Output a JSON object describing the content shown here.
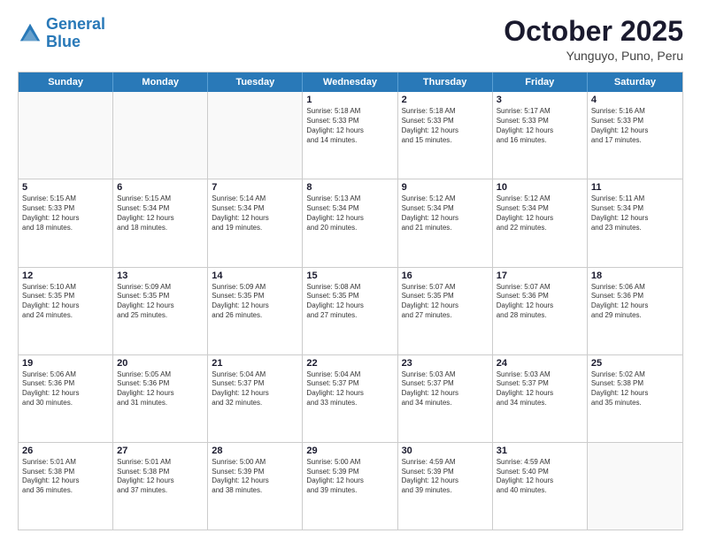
{
  "logo": {
    "text_general": "General",
    "text_blue": "Blue"
  },
  "header": {
    "month": "October 2025",
    "location": "Yunguyo, Puno, Peru"
  },
  "day_headers": [
    "Sunday",
    "Monday",
    "Tuesday",
    "Wednesday",
    "Thursday",
    "Friday",
    "Saturday"
  ],
  "weeks": [
    [
      {
        "day": "",
        "info": ""
      },
      {
        "day": "",
        "info": ""
      },
      {
        "day": "",
        "info": ""
      },
      {
        "day": "1",
        "info": "Sunrise: 5:18 AM\nSunset: 5:33 PM\nDaylight: 12 hours\nand 14 minutes."
      },
      {
        "day": "2",
        "info": "Sunrise: 5:18 AM\nSunset: 5:33 PM\nDaylight: 12 hours\nand 15 minutes."
      },
      {
        "day": "3",
        "info": "Sunrise: 5:17 AM\nSunset: 5:33 PM\nDaylight: 12 hours\nand 16 minutes."
      },
      {
        "day": "4",
        "info": "Sunrise: 5:16 AM\nSunset: 5:33 PM\nDaylight: 12 hours\nand 17 minutes."
      }
    ],
    [
      {
        "day": "5",
        "info": "Sunrise: 5:15 AM\nSunset: 5:33 PM\nDaylight: 12 hours\nand 18 minutes."
      },
      {
        "day": "6",
        "info": "Sunrise: 5:15 AM\nSunset: 5:34 PM\nDaylight: 12 hours\nand 18 minutes."
      },
      {
        "day": "7",
        "info": "Sunrise: 5:14 AM\nSunset: 5:34 PM\nDaylight: 12 hours\nand 19 minutes."
      },
      {
        "day": "8",
        "info": "Sunrise: 5:13 AM\nSunset: 5:34 PM\nDaylight: 12 hours\nand 20 minutes."
      },
      {
        "day": "9",
        "info": "Sunrise: 5:12 AM\nSunset: 5:34 PM\nDaylight: 12 hours\nand 21 minutes."
      },
      {
        "day": "10",
        "info": "Sunrise: 5:12 AM\nSunset: 5:34 PM\nDaylight: 12 hours\nand 22 minutes."
      },
      {
        "day": "11",
        "info": "Sunrise: 5:11 AM\nSunset: 5:34 PM\nDaylight: 12 hours\nand 23 minutes."
      }
    ],
    [
      {
        "day": "12",
        "info": "Sunrise: 5:10 AM\nSunset: 5:35 PM\nDaylight: 12 hours\nand 24 minutes."
      },
      {
        "day": "13",
        "info": "Sunrise: 5:09 AM\nSunset: 5:35 PM\nDaylight: 12 hours\nand 25 minutes."
      },
      {
        "day": "14",
        "info": "Sunrise: 5:09 AM\nSunset: 5:35 PM\nDaylight: 12 hours\nand 26 minutes."
      },
      {
        "day": "15",
        "info": "Sunrise: 5:08 AM\nSunset: 5:35 PM\nDaylight: 12 hours\nand 27 minutes."
      },
      {
        "day": "16",
        "info": "Sunrise: 5:07 AM\nSunset: 5:35 PM\nDaylight: 12 hours\nand 27 minutes."
      },
      {
        "day": "17",
        "info": "Sunrise: 5:07 AM\nSunset: 5:36 PM\nDaylight: 12 hours\nand 28 minutes."
      },
      {
        "day": "18",
        "info": "Sunrise: 5:06 AM\nSunset: 5:36 PM\nDaylight: 12 hours\nand 29 minutes."
      }
    ],
    [
      {
        "day": "19",
        "info": "Sunrise: 5:06 AM\nSunset: 5:36 PM\nDaylight: 12 hours\nand 30 minutes."
      },
      {
        "day": "20",
        "info": "Sunrise: 5:05 AM\nSunset: 5:36 PM\nDaylight: 12 hours\nand 31 minutes."
      },
      {
        "day": "21",
        "info": "Sunrise: 5:04 AM\nSunset: 5:37 PM\nDaylight: 12 hours\nand 32 minutes."
      },
      {
        "day": "22",
        "info": "Sunrise: 5:04 AM\nSunset: 5:37 PM\nDaylight: 12 hours\nand 33 minutes."
      },
      {
        "day": "23",
        "info": "Sunrise: 5:03 AM\nSunset: 5:37 PM\nDaylight: 12 hours\nand 34 minutes."
      },
      {
        "day": "24",
        "info": "Sunrise: 5:03 AM\nSunset: 5:37 PM\nDaylight: 12 hours\nand 34 minutes."
      },
      {
        "day": "25",
        "info": "Sunrise: 5:02 AM\nSunset: 5:38 PM\nDaylight: 12 hours\nand 35 minutes."
      }
    ],
    [
      {
        "day": "26",
        "info": "Sunrise: 5:01 AM\nSunset: 5:38 PM\nDaylight: 12 hours\nand 36 minutes."
      },
      {
        "day": "27",
        "info": "Sunrise: 5:01 AM\nSunset: 5:38 PM\nDaylight: 12 hours\nand 37 minutes."
      },
      {
        "day": "28",
        "info": "Sunrise: 5:00 AM\nSunset: 5:39 PM\nDaylight: 12 hours\nand 38 minutes."
      },
      {
        "day": "29",
        "info": "Sunrise: 5:00 AM\nSunset: 5:39 PM\nDaylight: 12 hours\nand 39 minutes."
      },
      {
        "day": "30",
        "info": "Sunrise: 4:59 AM\nSunset: 5:39 PM\nDaylight: 12 hours\nand 39 minutes."
      },
      {
        "day": "31",
        "info": "Sunrise: 4:59 AM\nSunset: 5:40 PM\nDaylight: 12 hours\nand 40 minutes."
      },
      {
        "day": "",
        "info": ""
      }
    ]
  ]
}
